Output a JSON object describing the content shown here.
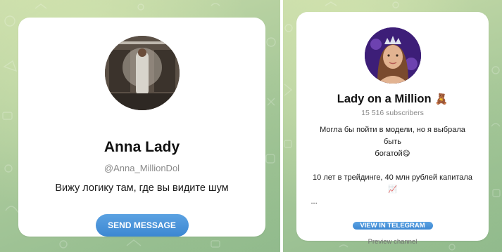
{
  "left_card": {
    "title": "Anna Lady",
    "username": "@Anna_MillionDol",
    "description": "Вижу логику там, где вы видите шум",
    "button_label": "SEND MESSAGE"
  },
  "right_card": {
    "title": "Lady on a Million",
    "title_emoji": "🧸",
    "subscribers": "15 516 subscribers",
    "description_line1": "Могла бы пойти в модели, но я выбрала быть",
    "description_line2": "богатой",
    "description_line2_emoji": "😋",
    "description_line3": "10 лет в трейдинге, 40 млн рублей капитала",
    "description_line3_emoji": "📈",
    "ellipsis": "...",
    "button_label": "VIEW IN TELEGRAM",
    "preview_label": "Preview channel"
  },
  "colors": {
    "button": "#3c87d2",
    "background": "#a9c99a"
  }
}
